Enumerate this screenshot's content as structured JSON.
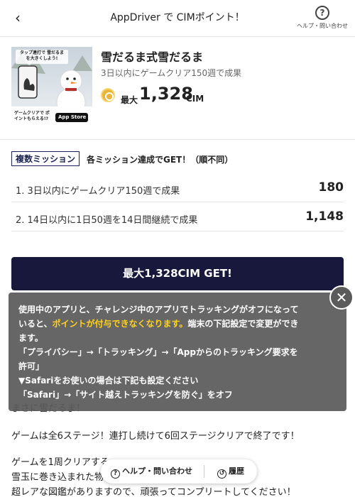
{
  "header": {
    "title": "AppDriver で CIMポイント！",
    "help_label": "ヘルプ・問い合わせ",
    "back_glyph": "‹",
    "help_glyph": "?"
  },
  "app": {
    "name": "雪だるま式雪だるま",
    "subtitle": "3日以内にゲームクリア150週で成果",
    "max_label": "最大",
    "max_amount": "1,328",
    "unit": "CIM",
    "thumb_banner": "タップ連打で 雪だるまを大きくしよう!",
    "thumb_caption": "ゲームクリアで ポイントもらえる!?",
    "thumb_store": "App Store"
  },
  "missions": {
    "badge": "複数ミッション",
    "note": "各ミッション達成でGET！（順不同）",
    "items": [
      {
        "text": "1. 3日以内にゲームクリア150週で成果",
        "value": "180"
      },
      {
        "text": "2. 14日以内に1日50週を14日間継続で成果",
        "value": "1,148"
      }
    ]
  },
  "cta": {
    "label": "最大1,328CIM GET!"
  },
  "description": {
    "line1": "まさに雪だるま！",
    "line2": "ゲームは全6ステージ！連打し続けて6回ステージクリアで終了です！",
    "line3": "ゲームを1周クリアする",
    "line4": "雪玉に巻き込まれた物",
    "line5": "超レアな図鑑がありますので、頑張ってコンプリートしてください！"
  },
  "overlay": {
    "line1": "使用中のアプリと、チャレンジ中のアプリでトラッキングがオフになって",
    "line2_pre": "いると、",
    "line2_hl": "ポイントが付与できなくなります。",
    "line2_post": "端末の下記設定で変更ができ",
    "line3": "ます。",
    "line4": "「プライバシー」→「トラッキング」→「Appからのトラッキング要求を",
    "line5": "許可」",
    "line6": "▼Safariをお使いの場合は下記も設定ください",
    "line7": "「Safari」→「サイト越えトラッキングを防ぐ」をオフ",
    "close_glyph": "✕"
  },
  "bottom_bar": {
    "help": "ヘルプ・問い合わせ",
    "history": "履歴",
    "help_glyph": "?",
    "history_glyph": "↺"
  },
  "colors": {
    "cta_bg": "#17183b",
    "highlight": "#ffd21e",
    "coin": "#e9b43a",
    "overlay_bg": "#5a5a5a"
  }
}
